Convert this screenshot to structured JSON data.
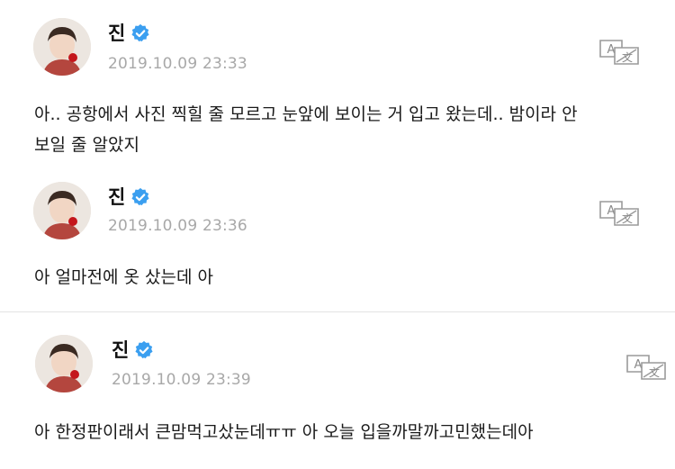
{
  "posts": [
    {
      "author": "진",
      "timestamp": "2019.10.09 23:33",
      "text_lines": [
        "아.. 공항에서 사진 찍힐 줄 모르고 눈앞에 보이는 거 입고 왔는데.. 밤이라 안",
        "보일 줄 알았지"
      ]
    },
    {
      "author": "진",
      "timestamp": "2019.10.09 23:36",
      "text_lines": [
        "아 얼마전에 옷 샀는데 아"
      ]
    },
    {
      "author": "진",
      "timestamp": "2019.10.09 23:39",
      "text_lines": [
        "아 한정판이래서 큰맘먹고샀눈데ㅠㅠ 아 오늘 입을까말까고민했는데아"
      ]
    }
  ],
  "icons": {
    "verified": "verified-badge-icon",
    "translate": "translate-icon"
  },
  "colors": {
    "verified_blue": "#3b9ff0",
    "timestamp_gray": "#a8a8a8",
    "divider": "#e3e3e3"
  }
}
